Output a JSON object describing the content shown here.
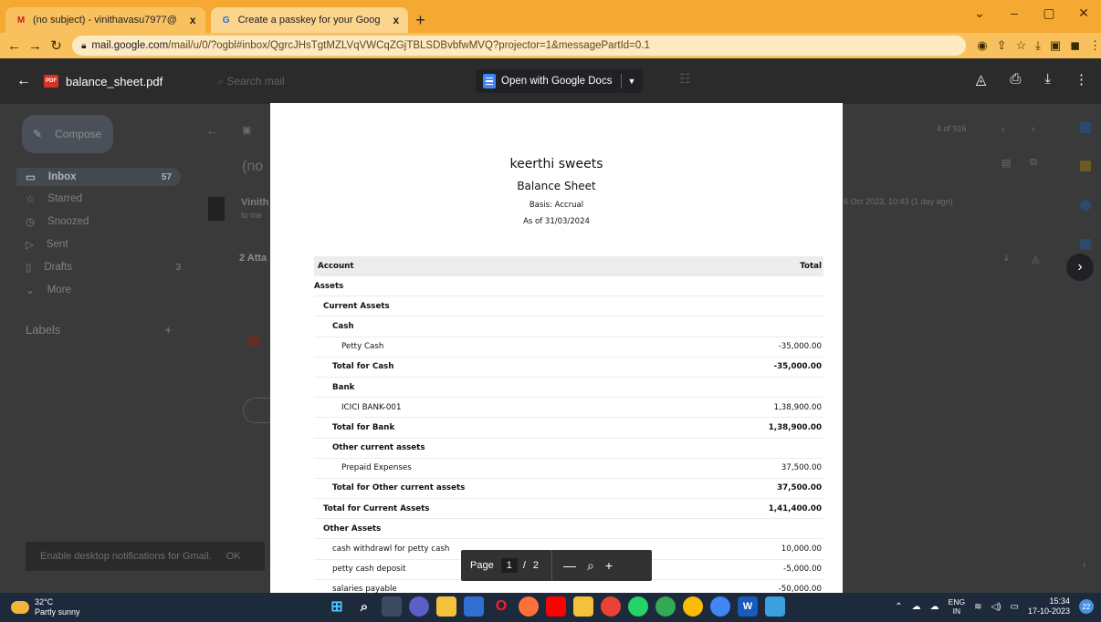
{
  "browser": {
    "tabs": [
      {
        "title": "(no subject) - vinithavasu7977@",
        "close": "x",
        "favicon": "gmail-icon"
      },
      {
        "title": "Create a passkey for your Goog",
        "close": "x",
        "favicon": "google-icon"
      }
    ],
    "new_tab": "+",
    "url_host": "mail.google.com",
    "url_path": "/mail/u/0/?ogbl#inbox/QgrcJHsTgtMZLVqVWCqZGjTBLSDBvbfwMVQ?projector=1&messagePartId=0.1"
  },
  "gmail": {
    "compose": "Compose",
    "nav": [
      {
        "label": "Inbox",
        "count": "57"
      },
      {
        "label": "Starred",
        "count": ""
      },
      {
        "label": "Snoozed",
        "count": ""
      },
      {
        "label": "Sent",
        "count": ""
      },
      {
        "label": "Drafts",
        "count": "3"
      },
      {
        "label": "More",
        "count": ""
      }
    ],
    "labels": "Labels",
    "subject_partial": "(no",
    "sender_partial": "Vinith",
    "to_partial": "to me",
    "attachments_partial": "2 Atta",
    "date_text": "6 Oct 2023, 10:43 (1 day ago)",
    "pager": "4 of 916",
    "notification": "Enable desktop notifications for Gmail.",
    "notification_ok": "OK",
    "search_placeholder": "Search mail"
  },
  "viewer": {
    "file_name": "balance_sheet.pdf",
    "open_with": "Open with Google Docs",
    "pdf_badge": "PDF"
  },
  "report": {
    "company": "keerthi sweets",
    "title": "Balance Sheet",
    "basis": "Basis: Accrual",
    "as_of": "As of 31/03/2024",
    "col_account": "Account",
    "col_total": "Total",
    "rows": [
      {
        "label": "Assets",
        "total": "",
        "bold": true,
        "indent": 1
      },
      {
        "label": "Current Assets",
        "total": "",
        "bold": true,
        "indent": 2
      },
      {
        "label": "Cash",
        "total": "",
        "bold": true,
        "indent": 3
      },
      {
        "label": "Petty Cash",
        "total": "-35,000.00",
        "bold": false,
        "indent": 4
      },
      {
        "label": "Total for Cash",
        "total": "-35,000.00",
        "bold": true,
        "indent": 3
      },
      {
        "label": "Bank",
        "total": "",
        "bold": true,
        "indent": 3
      },
      {
        "label": "ICICI BANK-001",
        "total": "1,38,900.00",
        "bold": false,
        "indent": 4
      },
      {
        "label": "Total for Bank",
        "total": "1,38,900.00",
        "bold": true,
        "indent": 3
      },
      {
        "label": "Other current assets",
        "total": "",
        "bold": true,
        "indent": 3
      },
      {
        "label": "Prepaid Expenses",
        "total": "37,500.00",
        "bold": false,
        "indent": 4
      },
      {
        "label": "Total for Other current assets",
        "total": "37,500.00",
        "bold": true,
        "indent": 3
      },
      {
        "label": "Total for Current Assets",
        "total": "1,41,400.00",
        "bold": true,
        "indent": 2
      },
      {
        "label": "Other Assets",
        "total": "",
        "bold": true,
        "indent": 2
      },
      {
        "label": "cash withdrawl for petty cash",
        "total": "10,000.00",
        "bold": false,
        "indent": 3
      },
      {
        "label": "petty cash deposit",
        "total": "-5,000.00",
        "bold": false,
        "indent": 3
      },
      {
        "label": "salaries payable",
        "total": "-50,000.00",
        "bold": false,
        "indent": 3
      }
    ]
  },
  "pagenav": {
    "label": "Page",
    "current": "1",
    "sep": "/",
    "total": "2"
  },
  "taskbar": {
    "temp": "32°C",
    "weather": "Partly sunny",
    "lang1": "ENG",
    "lang2": "IN",
    "time": "15:34",
    "date": "17-10-2023",
    "badge": "22"
  }
}
